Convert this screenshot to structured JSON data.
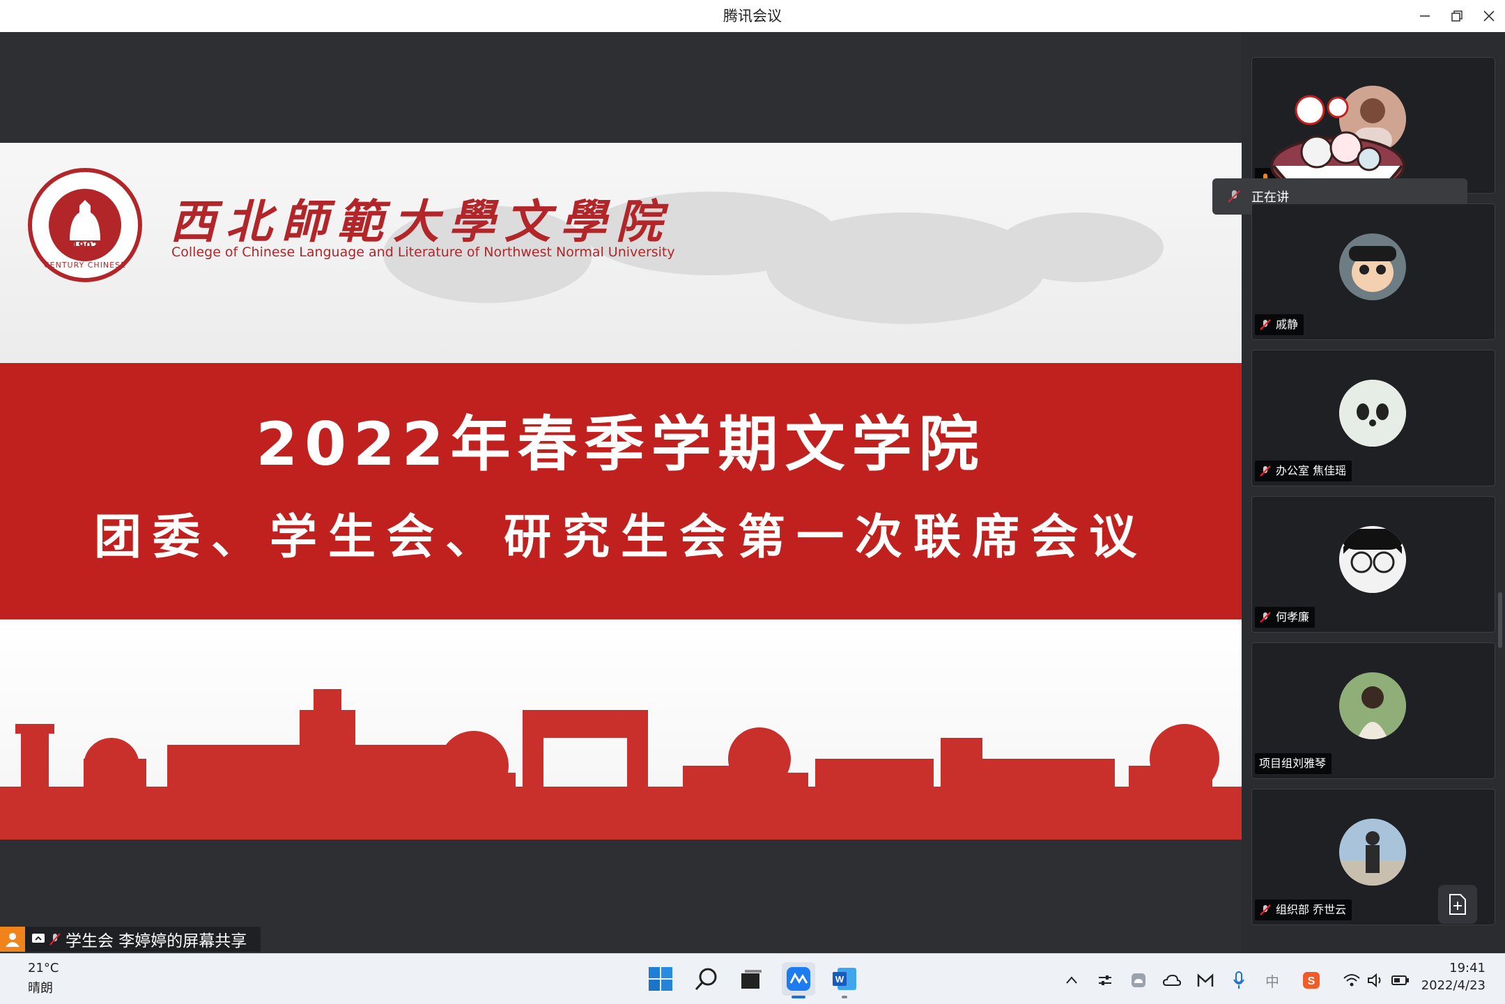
{
  "window": {
    "title": "腾讯会议"
  },
  "slide": {
    "college_cn": "西北師範大學文學院",
    "college_en": "College of Chinese Language and Literature of Northwest Normal University",
    "seal_year": "1902",
    "seal_ring_text": "CENTURY CHINESE",
    "title_line1": "2022年春季学期文学院",
    "title_line2": "团委、学生会、研究生会第一次联席会议"
  },
  "toast": {
    "text": "正在讲"
  },
  "participants": [
    {
      "name": "",
      "muted": true
    },
    {
      "name": "戚静",
      "muted": true
    },
    {
      "name": "办公室 焦佳瑶",
      "muted": true
    },
    {
      "name": "何孝廉",
      "muted": true
    },
    {
      "name": "项目组刘雅琴",
      "muted": false
    },
    {
      "name": "组织部 乔世云",
      "muted": true
    }
  ],
  "share_bar": {
    "text": "学生会 李婷婷的屏幕共享"
  },
  "taskbar": {
    "weather_temp": "21°C",
    "weather_desc": "晴朗",
    "time": "19:41",
    "date": "2022/4/23",
    "ime": "中"
  },
  "colors": {
    "accent_red": "#c0211f",
    "dark_bg": "#2d2f33",
    "share_orange": "#f0841a"
  }
}
